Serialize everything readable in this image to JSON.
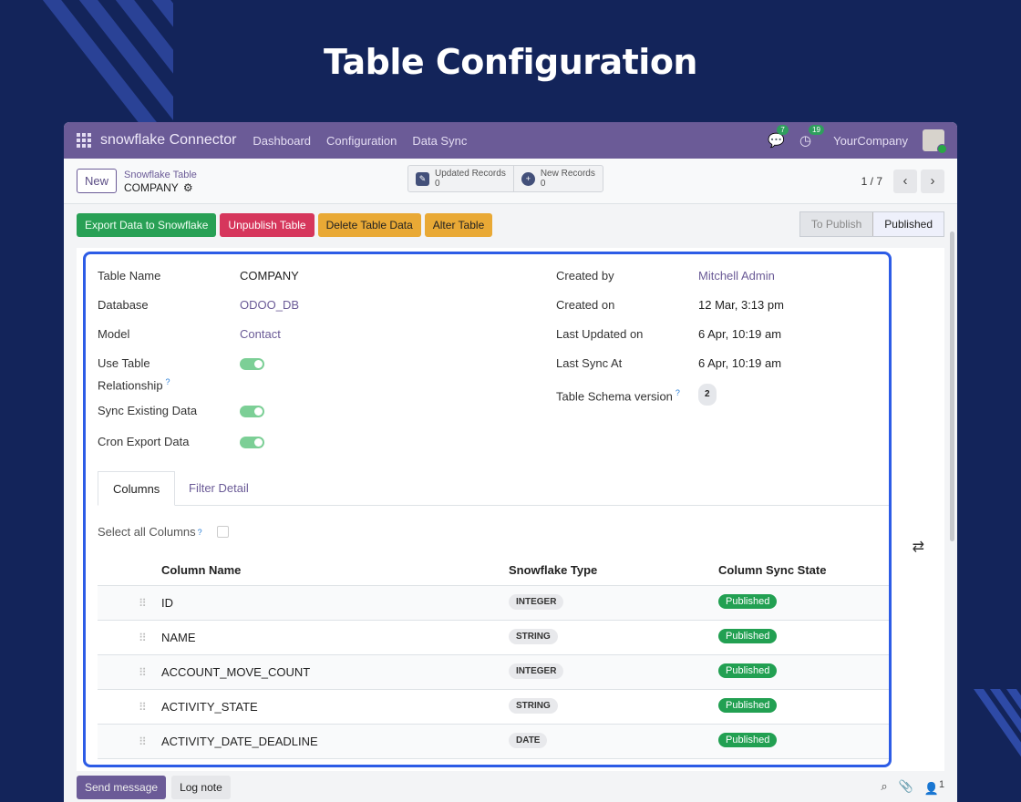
{
  "hero": {
    "title": "Table Configuration"
  },
  "navbar": {
    "app_name": "snowflake Connector",
    "menu": [
      "Dashboard",
      "Configuration",
      "Data Sync"
    ],
    "messages_count": "7",
    "activities_count": "19",
    "company": "YourCompany"
  },
  "control": {
    "new_label": "New",
    "breadcrumb_parent": "Snowflake Table",
    "breadcrumb_current": "COMPANY",
    "stats": [
      {
        "label": "Updated Records",
        "value": "0",
        "icon": "pencil-square-icon"
      },
      {
        "label": "New Records",
        "value": "0",
        "icon": "plus-circle-icon"
      }
    ],
    "pager": "1 / 7"
  },
  "actions": {
    "buttons": [
      "Export Data to Snowflake",
      "Unpublish Table",
      "Delete Table Data",
      "Alter Table"
    ],
    "colors": {
      "export": "#28a055",
      "unpublish": "#d6365c",
      "delete": "#e9a935",
      "alter": "#e9a935"
    },
    "status_stages": [
      "To Publish",
      "Published"
    ],
    "current_stage": "Published"
  },
  "form": {
    "left": [
      {
        "label": "Table Name",
        "value": "COMPANY"
      },
      {
        "label": "Database",
        "value": "ODOO_DB"
      },
      {
        "label": "Model",
        "value": "Contact"
      },
      {
        "label": "Use Table Relationship",
        "toggle": true
      },
      {
        "label": "Sync Existing Data",
        "toggle": true
      },
      {
        "label": "Cron Export Data",
        "toggle": true
      }
    ],
    "right": [
      {
        "label": "Created by",
        "value": "Mitchell Admin"
      },
      {
        "label": "Created on",
        "value": "12 Mar, 3:13 pm"
      },
      {
        "label": "Last Updated on",
        "value": "6 Apr, 10:19 am"
      },
      {
        "label": "Last Sync At",
        "value": "6 Apr, 10:19 am"
      },
      {
        "label": "Table Schema version",
        "value": "2"
      }
    ]
  },
  "tabs": [
    "Columns",
    "Filter Detail"
  ],
  "columns_tab": {
    "select_all_label": "Select all Columns",
    "headers": [
      "Column Name",
      "Snowflake Type",
      "Column Sync State"
    ],
    "rows": [
      {
        "name": "ID",
        "type": "INTEGER",
        "state": "Published"
      },
      {
        "name": "NAME",
        "type": "STRING",
        "state": "Published"
      },
      {
        "name": "ACCOUNT_MOVE_COUNT",
        "type": "INTEGER",
        "state": "Published"
      },
      {
        "name": "ACTIVITY_STATE",
        "type": "STRING",
        "state": "Published"
      },
      {
        "name": "ACTIVITY_DATE_DEADLINE",
        "type": "DATE",
        "state": "Published"
      }
    ]
  },
  "chatter": {
    "send_label": "Send message",
    "log_label": "Log note",
    "followers_count": "1"
  }
}
